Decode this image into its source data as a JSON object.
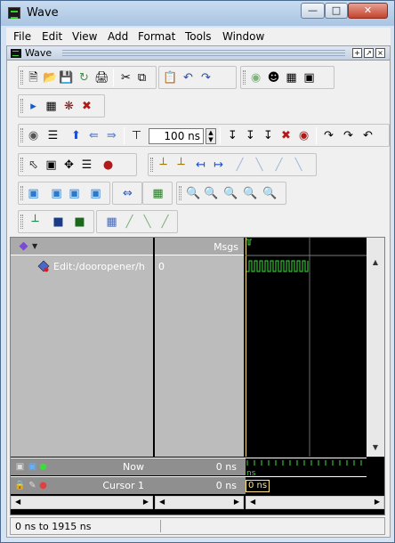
{
  "window": {
    "title": "Wave"
  },
  "menubar": [
    "File",
    "Edit",
    "View",
    "Add",
    "Format",
    "Tools",
    "Window"
  ],
  "panel": {
    "title": "Wave"
  },
  "toolbar": {
    "run_length": "100 ns"
  },
  "wave": {
    "headers": {
      "msgs": "Msgs"
    },
    "signals": [
      {
        "name": "Edit:/dooropener/h",
        "value": "0"
      }
    ],
    "now": {
      "label": "Now",
      "value": "0 ns"
    },
    "cursor": {
      "label": "Cursor 1",
      "value": "0 ns",
      "wave_label": "0 ns",
      "time_tick": "ns"
    }
  },
  "status": {
    "range": "0 ns to 1915 ns"
  },
  "colors": {
    "wave_green": "#3ddc3d",
    "cursor_yellow": "#ffe680"
  }
}
